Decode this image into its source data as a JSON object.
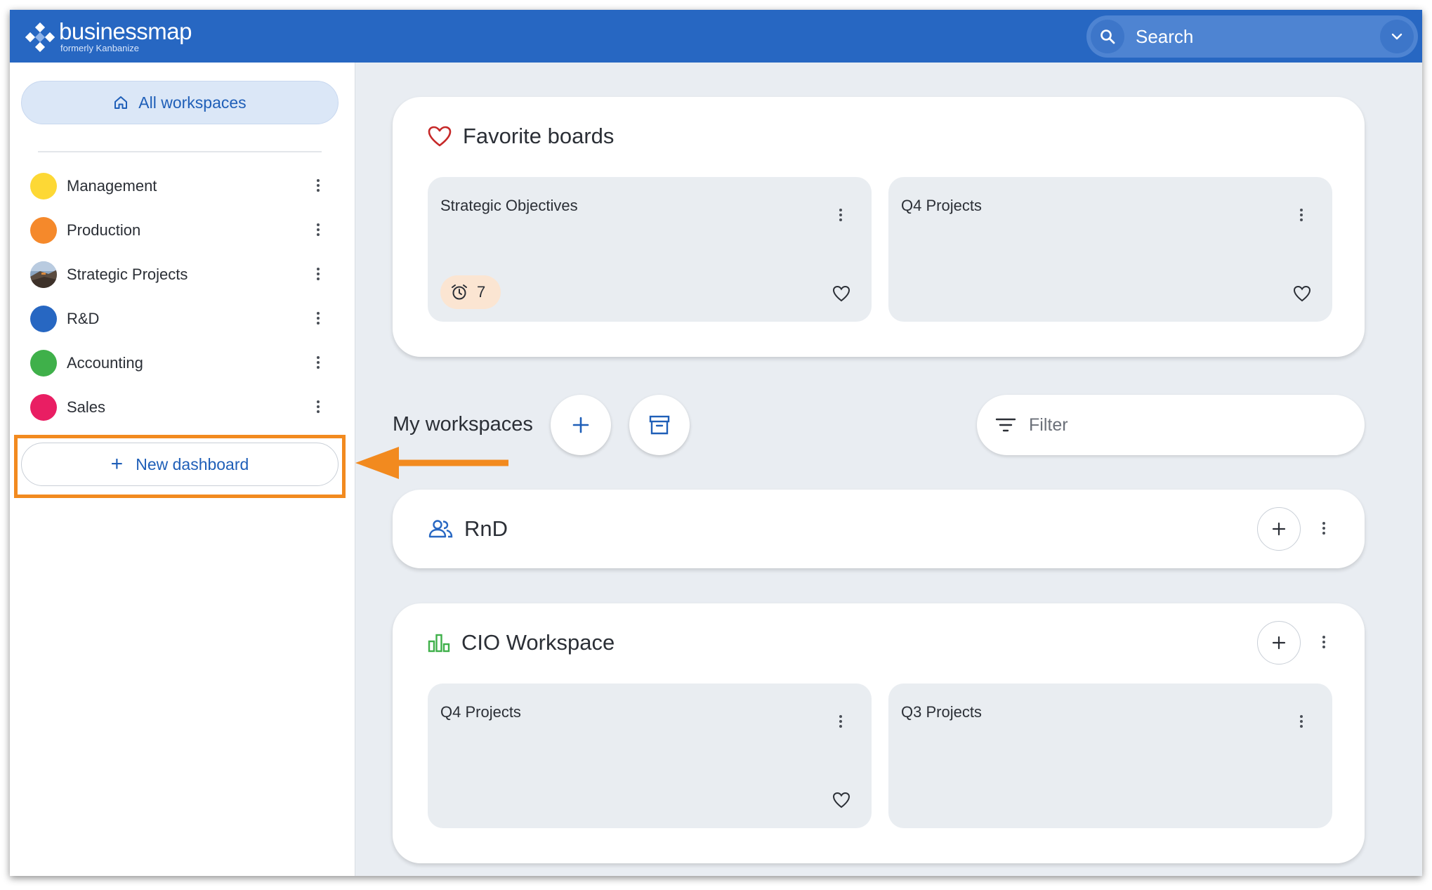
{
  "brand": {
    "name": "businessmap",
    "tagline": "formerly Kanbanize"
  },
  "search": {
    "label": "Search"
  },
  "sidebar": {
    "all_workspaces_label": "All workspaces",
    "workspaces": [
      {
        "label": "Management",
        "color": "#fdd835"
      },
      {
        "label": "Production",
        "color": "#f5892b"
      },
      {
        "label": "Strategic Projects",
        "color": "image"
      },
      {
        "label": "R&D",
        "color": "#2767c2"
      },
      {
        "label": "Accounting",
        "color": "#3fb04a"
      },
      {
        "label": "Sales",
        "color": "#e91e63"
      }
    ],
    "new_dashboard_label": "New dashboard"
  },
  "favorites": {
    "title": "Favorite boards",
    "boards": [
      {
        "title": "Strategic Objectives",
        "alarm_count": "7"
      },
      {
        "title": "Q4 Projects"
      }
    ]
  },
  "my_workspaces": {
    "title": "My workspaces",
    "filter_placeholder": "Filter"
  },
  "workspaces_main": [
    {
      "title": "RnD"
    },
    {
      "title": "CIO Workspace",
      "boards": [
        {
          "title": "Q4 Projects"
        },
        {
          "title": "Q3 Projects"
        }
      ]
    }
  ],
  "colors": {
    "header": "#2767c2",
    "accent": "#1f5fb8",
    "highlight": "#f28a1f",
    "favorite_heart": "#c62828",
    "workspace_green": "#3fb04a"
  }
}
